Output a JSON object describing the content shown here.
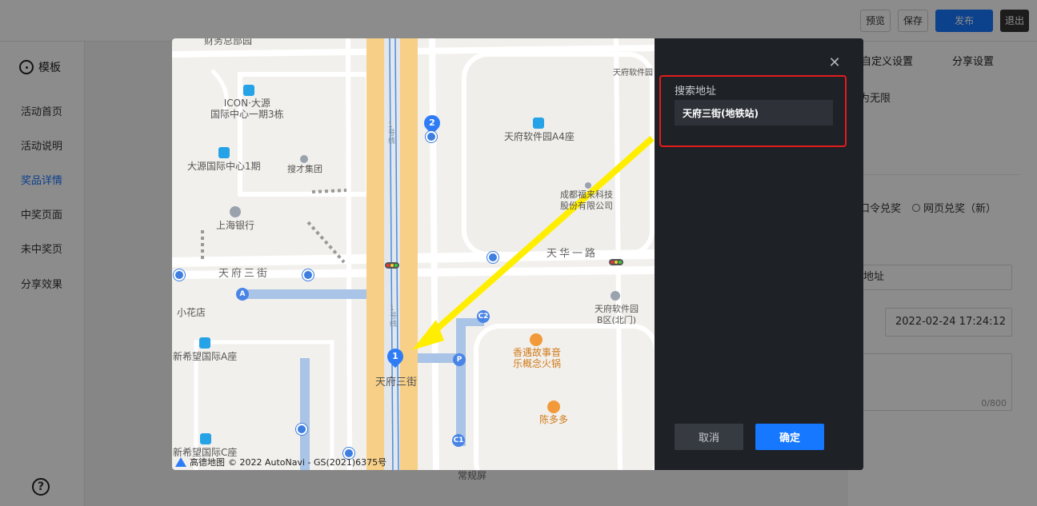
{
  "toolbar": {
    "preview": "预览",
    "save": "保存",
    "publish": "发布",
    "exit": "退出"
  },
  "sidebar": {
    "title": "模板",
    "items": [
      {
        "label": "活动首页"
      },
      {
        "label": "活动说明"
      },
      {
        "label": "奖品详情"
      },
      {
        "label": "中奖页面"
      },
      {
        "label": "未中奖页"
      },
      {
        "label": "分享效果"
      }
    ],
    "active_index": 2
  },
  "right_panel": {
    "tabs": [
      "自定义设置",
      "分享设置"
    ],
    "limit_text": "为无限",
    "redeem_option_1": "口令兑奖",
    "redeem_option_2": "网页兑奖（新）",
    "address_field": "地址",
    "datetime_value": "2022-02-24 17:24:12",
    "char_counter": "0/800"
  },
  "under_modal_text": "常规屏",
  "modal": {
    "search_label": "搜索地址",
    "search_value": "天府三街(地铁站)",
    "cancel_label": "取消",
    "confirm_label": "确定"
  },
  "map": {
    "labels": {
      "top_cut": "财务总部园",
      "icon_tower": "ICON·大源\n国际中心一期3栋",
      "dayuan": "大源国际中心1期",
      "soucai": "搜才集团",
      "shanghai_bank": "上海银行",
      "tfsoft_a4": "天府软件园A4座",
      "tfsoft_cut": "天府软件园",
      "chengdu_co": "成都福来科技\n股份有限公司",
      "tianhua": "天华一路",
      "tianfu3": "天府三街",
      "flower": "小花店",
      "xinxiwang_a": "新希望国际A座",
      "xinxiwang_c": "新希望国际C座",
      "tfsoft_b": "天府软件园\nB区(北门)",
      "hotpot": "香遇故事音\n乐概念火锅",
      "chenduoduo": "陈多多",
      "station": "天府三街",
      "line1_a": "1号线",
      "line1_b": "1号线"
    },
    "markers": [
      "1",
      "2",
      "A",
      "C2",
      "C1",
      "P"
    ],
    "footer": "© 2022 AutoNavi - GS(2021)6375号",
    "logo_text": "高德地图"
  },
  "colors": {
    "accent": "#1677ff",
    "highlight": "#e31c1c",
    "arrow": "#ffee00",
    "panel": "#1e2126"
  }
}
